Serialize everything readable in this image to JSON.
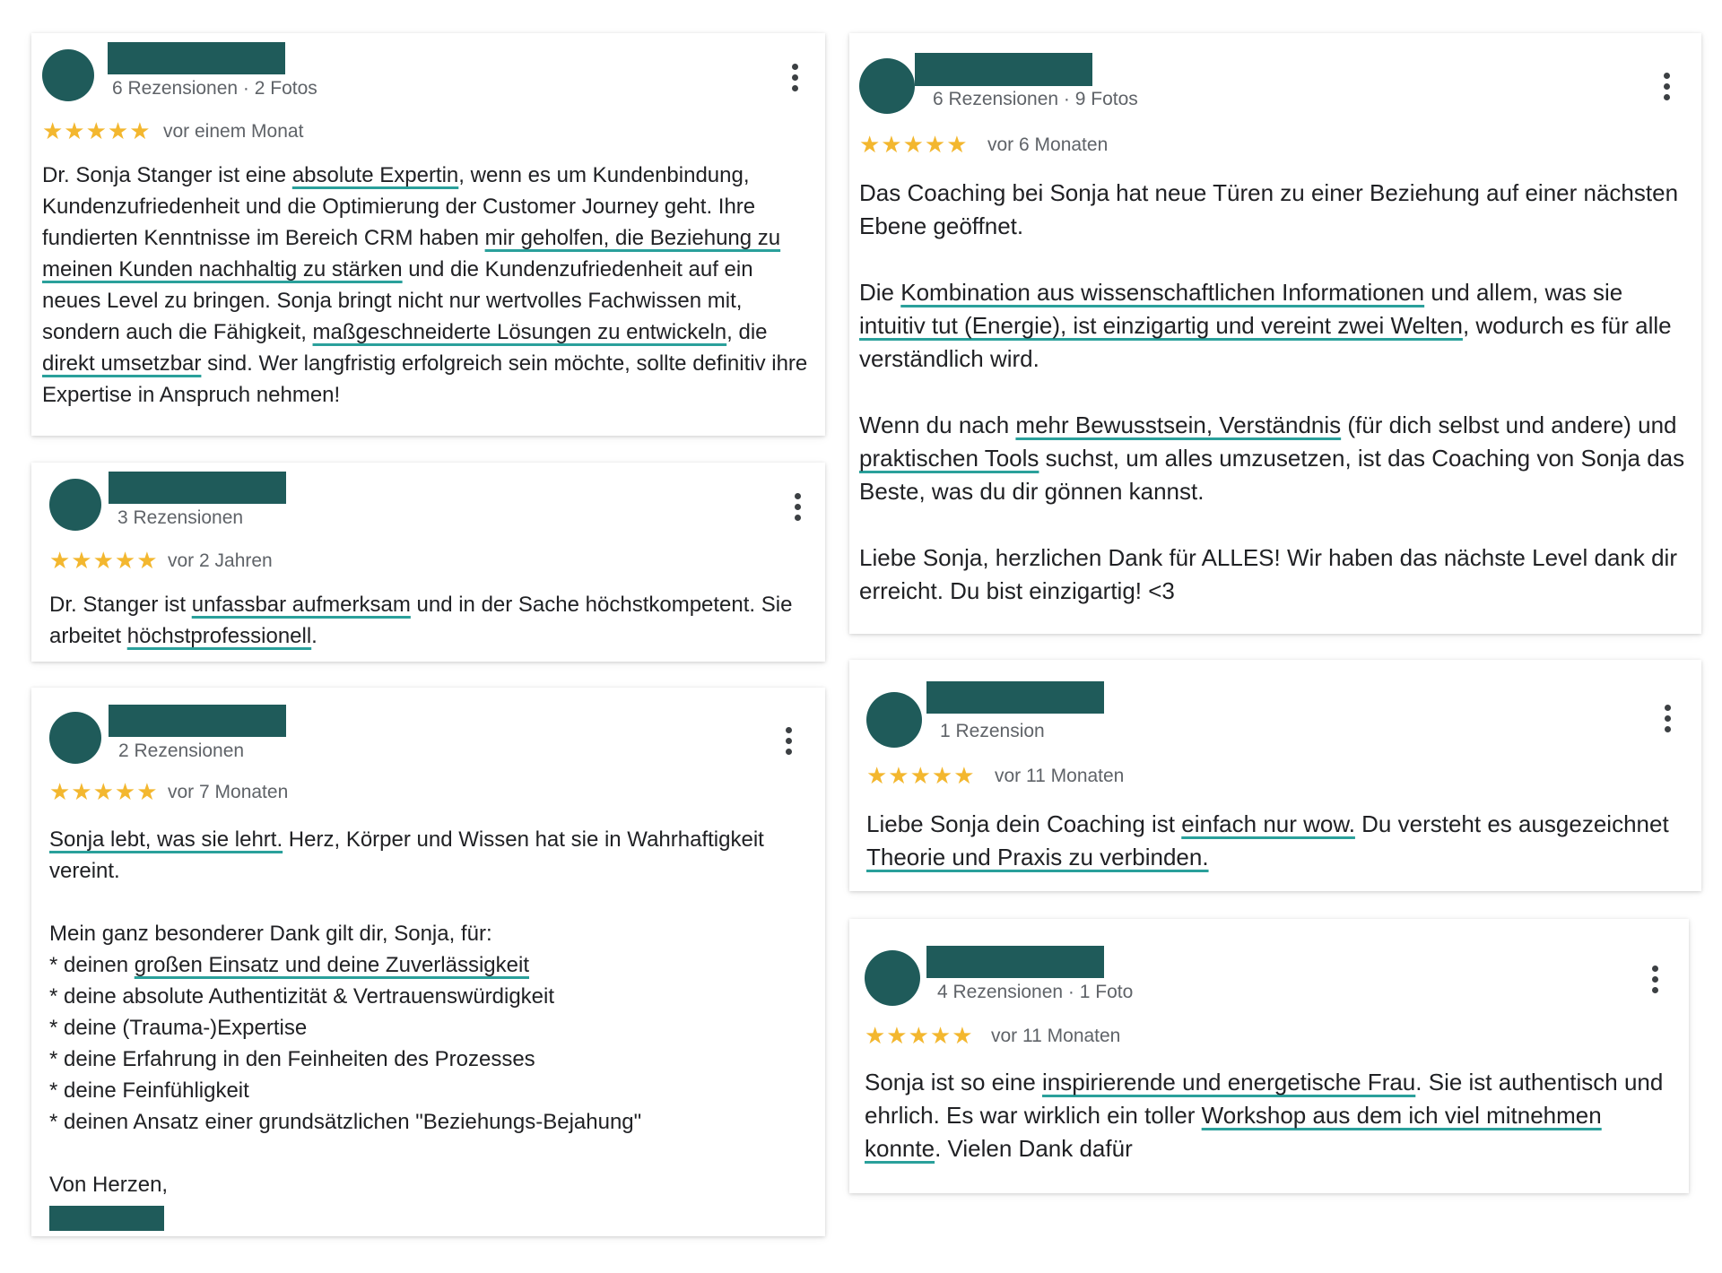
{
  "colors": {
    "accent": "#1f5b5a",
    "underline": "#2aa09b",
    "star": "#f3b72f"
  },
  "icons": {
    "rating": "star-icon",
    "menu": "more-vert-icon"
  },
  "reviews": [
    {
      "meta": "6 Rezensionen · 2 Fotos",
      "stars": "★★★★★",
      "rating": 5,
      "time": "vor einem Monat",
      "text": {
        "s1": "Dr. Sonja Stanger ist eine ",
        "h1": "absolute Expertin",
        "s2": ", wenn es um Kundenbindung, Kundenzufriedenheit und die Optimierung der Customer Journey geht. Ihre fundierten Kenntnisse im Bereich CRM haben ",
        "h2": "mir geholfen, die Beziehung zu meinen Kunden nachhaltig zu stärken",
        "s3": " und die Kundenzufriedenheit auf ein neues Level zu bringen. Sonja bringt nicht nur wertvolles Fachwissen mit, sondern auch die Fähigkeit, ",
        "h3": "maßgeschneiderte Lösungen zu entwickeln",
        "s4": ", die ",
        "h4": "direkt umsetzbar",
        "s5": " sind. Wer langfristig erfolgreich sein möchte, sollte definitiv ihre Expertise in Anspruch nehmen!"
      }
    },
    {
      "meta": "3 Rezensionen",
      "stars": "★★★★★",
      "rating": 5,
      "time": "vor 2 Jahren",
      "text": {
        "s1": "Dr. Stanger ist ",
        "h1": "unfassbar aufmerksam",
        "s2": " und in der Sache höchstkompetent. Sie arbeitet ",
        "h2": "höchstprofessionell",
        "s3": "."
      }
    },
    {
      "meta": "2 Rezensionen",
      "stars": "★★★★★",
      "rating": 5,
      "time": "vor 7 Monaten",
      "text": {
        "h1": "Sonja lebt, was sie lehrt.",
        "s1": " Herz, Körper und Wissen hat sie in Wahrhaftigkeit vereint.",
        "intro": "Mein ganz besonderer Dank gilt dir, Sonja, für:",
        "b1a": "* deinen ",
        "b1h": "großen Einsatz und deine Zuverlässigkeit",
        "b2": "* deine absolute Authentizität & Vertrauenswürdigkeit",
        "b3": "* deine (Trauma-)Expertise",
        "b4": "* deine Erfahrung in den Feinheiten des Prozesses",
        "b5": "* deine Feinfühligkeit",
        "b6": "* deinen Ansatz einer grundsätzlichen \"Beziehungs-Bejahung\"",
        "closing": "Von Herzen,"
      }
    },
    {
      "meta": "6 Rezensionen · 9 Fotos",
      "stars": "★★★★★",
      "rating": 5,
      "time": "vor 6 Monaten",
      "text": {
        "p1": "Das Coaching bei Sonja hat neue Türen zu einer Beziehung auf einer nächsten Ebene geöffnet.",
        "p2a": "Die ",
        "p2h1": "Kombination aus wissenschaftlichen Informationen",
        "p2b": " und allem, was sie ",
        "p2h2": "intuitiv tut (Energie), ist einzigartig und vereint zwei Welten",
        "p2c": ", wodurch es für alle verständlich wird.",
        "p3a": "Wenn du nach ",
        "p3h1": "mehr Bewusstsein, Verständnis",
        "p3b": " (für dich selbst und andere) und ",
        "p3h2": "praktischen Tools",
        "p3c": " suchst, um alles umzusetzen, ist das Coaching von Sonja das Beste, was du dir gönnen kannst.",
        "p4": "Liebe Sonja, herzlichen Dank für ALLES! Wir haben das nächste Level dank dir erreicht. Du bist einzigartig! <3"
      }
    },
    {
      "meta": "1 Rezension",
      "stars": "★★★★★",
      "rating": 5,
      "time": "vor 11 Monaten",
      "text": {
        "s1": "Liebe Sonja dein Coaching ist ",
        "h1": "einfach nur wow.",
        "s2": " Du versteht es ausgezeichnet ",
        "h2": "Theorie und Praxis zu verbinden."
      }
    },
    {
      "meta": "4 Rezensionen · 1 Foto",
      "stars": "★★★★★",
      "rating": 5,
      "time": "vor 11 Monaten",
      "text": {
        "s1": "Sonja ist so eine ",
        "h1": "inspirierende und energetische Frau",
        "s2": ". Sie ist authentisch und ehrlich. Es war wirklich ein toller ",
        "h2": "Workshop aus dem ich viel mitnehmen konnte",
        "s3": ". Vielen Dank dafür"
      }
    }
  ]
}
